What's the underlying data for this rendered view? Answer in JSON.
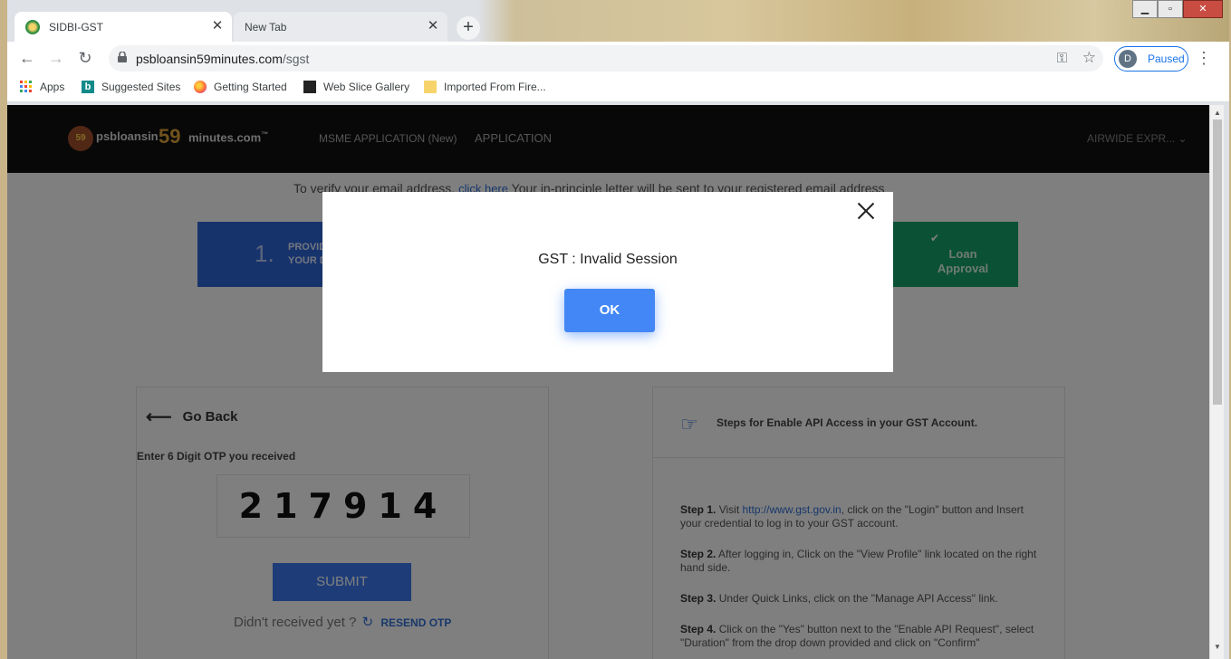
{
  "browser": {
    "tabs": [
      {
        "title": "SIDBI-GST",
        "active": true
      },
      {
        "title": "New Tab",
        "active": false
      }
    ],
    "close_glyph": "✕",
    "new_tab_glyph": "+",
    "window_controls": {
      "minimize": "▁",
      "maximize": "▫",
      "close": "✕"
    },
    "nav": {
      "back": "←",
      "forward": "→",
      "reload": "↻"
    },
    "url_host": "psbloansin59minutes.com",
    "url_path": "/sgst",
    "profile": {
      "initial": "D",
      "status": "Paused"
    },
    "menu": "⋮",
    "bookmarks": [
      "Apps",
      "Suggested Sites",
      "Getting Started",
      "Web Slice Gallery",
      "Imported From Fire..."
    ]
  },
  "site": {
    "logo_badge": "59",
    "logo_text": "psbloansin",
    "logo_num": "59",
    "logo_domain": "minutes.com",
    "logo_tm": "™",
    "nav": [
      "MSME APPLICATION (New)",
      "APPLICATION"
    ],
    "user": "AIRWIDE EXPR..."
  },
  "verify": {
    "before": "To verify your email address,",
    "link": "click here",
    "after": "Your in-principle letter will be sent to your registered email address"
  },
  "steps_bar": {
    "first_num": "1.",
    "first_line1": "PROVIDE",
    "first_line2": "YOUR D",
    "last_check": "✔",
    "last_label": "Loan Approval"
  },
  "otp_card": {
    "go_back": "Go Back",
    "otp_label": "Enter 6 Digit OTP you received",
    "otp_value": "217914",
    "submit": "SUBMIT",
    "resend_prompt": "Didn't received yet ?",
    "resend": "RESEND OTP"
  },
  "api_card": {
    "title": "Steps for Enable API Access in your GST Account.",
    "steps": [
      {
        "label": "Step 1.",
        "pre": "Visit",
        "link": "http://www.gst.gov.in",
        "text": ", click on the \"Login\" button and Insert your credential to log in to your GST account."
      },
      {
        "label": "Step 2.",
        "text": "After logging in, Click on the \"View Profile\" link located on the right hand side."
      },
      {
        "label": "Step 3.",
        "text": "Under Quick Links, click on the \"Manage API Access\" link."
      },
      {
        "label": "Step 4.",
        "text": "Click on the \"Yes\" button next to the \"Enable API Request\", select \"Duration\" from the drop down provided and click on \"Confirm\""
      }
    ]
  },
  "modal": {
    "message": "GST : Invalid Session",
    "ok": "OK"
  },
  "colors": {
    "primary": "#4287f5",
    "header": "#111111",
    "step_blue": "#2f66d8",
    "step_green": "#17a36a"
  }
}
